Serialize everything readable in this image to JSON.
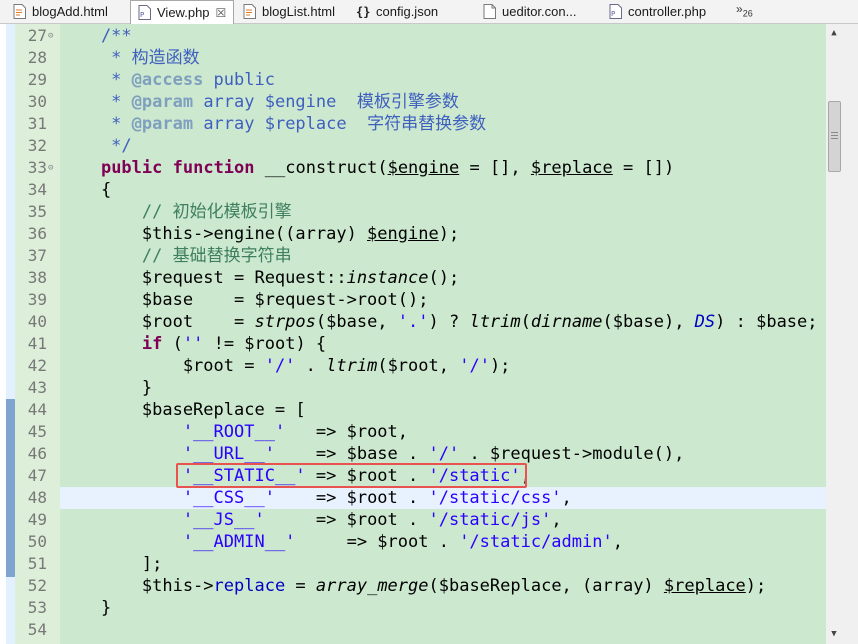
{
  "tabs": [
    {
      "label": "blogAdd.html",
      "icon": "html-file-icon",
      "active": false
    },
    {
      "label": "View.php",
      "icon": "php-file-icon",
      "active": true
    },
    {
      "label": "blogList.html",
      "icon": "html-file-icon",
      "active": false
    },
    {
      "label": "config.json",
      "icon": "json-file-icon",
      "active": false
    },
    {
      "label": "ueditor.con...",
      "icon": "generic-file-icon",
      "active": false
    },
    {
      "label": "controller.php",
      "icon": "php-file-icon",
      "active": false
    }
  ],
  "tab_close_glyph": "☒",
  "overflow": {
    "arrows": "»",
    "count": "26"
  },
  "editor": {
    "current_line": 48,
    "highlighted_line": 47,
    "lines": [
      {
        "n": "27",
        "fold": "⊝",
        "segs": [
          [
            "doc",
            "    /**"
          ]
        ]
      },
      {
        "n": "28",
        "segs": [
          [
            "doc",
            "     * 构造函数"
          ]
        ]
      },
      {
        "n": "29",
        "segs": [
          [
            "doc",
            "     * "
          ],
          [
            "tag",
            "@access"
          ],
          [
            "doc",
            " public"
          ]
        ]
      },
      {
        "n": "30",
        "segs": [
          [
            "doc",
            "     * "
          ],
          [
            "tag",
            "@param"
          ],
          [
            "doc",
            " array $engine  模板引擎参数"
          ]
        ]
      },
      {
        "n": "31",
        "segs": [
          [
            "doc",
            "     * "
          ],
          [
            "tag",
            "@param"
          ],
          [
            "doc",
            " array $replace  字符串替换参数"
          ]
        ]
      },
      {
        "n": "32",
        "segs": [
          [
            "doc",
            "     */"
          ]
        ]
      },
      {
        "n": "33",
        "fold": "⊝",
        "segs": [
          [
            "txt",
            "    "
          ],
          [
            "kw",
            "public"
          ],
          [
            "txt",
            " "
          ],
          [
            "kw",
            "function"
          ],
          [
            "txt",
            " __construct("
          ],
          [
            "uvar",
            "$engine"
          ],
          [
            "txt",
            " = [], "
          ],
          [
            "uvar",
            "$replace"
          ],
          [
            "txt",
            " = [])"
          ]
        ]
      },
      {
        "n": "34",
        "segs": [
          [
            "txt",
            "    {"
          ]
        ]
      },
      {
        "n": "35",
        "segs": [
          [
            "com",
            "        // 初始化模板引擎"
          ]
        ]
      },
      {
        "n": "36",
        "segs": [
          [
            "txt",
            "        $this->engine((array) "
          ],
          [
            "uvar",
            "$engine"
          ],
          [
            "txt",
            ");"
          ]
        ]
      },
      {
        "n": "37",
        "segs": [
          [
            "com",
            "        // 基础替换字符串"
          ]
        ]
      },
      {
        "n": "38",
        "segs": [
          [
            "txt",
            "        $request = Request::"
          ],
          [
            "it",
            "instance"
          ],
          [
            "txt",
            "();"
          ]
        ]
      },
      {
        "n": "39",
        "segs": [
          [
            "txt",
            "        $base    = $request->root();"
          ]
        ]
      },
      {
        "n": "40",
        "segs": [
          [
            "txt",
            "        $root    = "
          ],
          [
            "it",
            "strpos"
          ],
          [
            "txt",
            "($base, "
          ],
          [
            "str",
            "'.'"
          ],
          [
            "txt",
            ") ? "
          ],
          [
            "it",
            "ltrim"
          ],
          [
            "txt",
            "("
          ],
          [
            "it",
            "dirname"
          ],
          [
            "txt",
            "($base), "
          ],
          [
            "cn",
            "DS"
          ],
          [
            "txt",
            ") : $base;"
          ]
        ]
      },
      {
        "n": "41",
        "segs": [
          [
            "txt",
            "        "
          ],
          [
            "kw",
            "if"
          ],
          [
            "txt",
            " ("
          ],
          [
            "str",
            "''"
          ],
          [
            "txt",
            " != $root) {"
          ]
        ]
      },
      {
        "n": "42",
        "segs": [
          [
            "txt",
            "            $root = "
          ],
          [
            "str",
            "'/'"
          ],
          [
            "txt",
            " . "
          ],
          [
            "it",
            "ltrim"
          ],
          [
            "txt",
            "($root, "
          ],
          [
            "str",
            "'/'"
          ],
          [
            "txt",
            ");"
          ]
        ]
      },
      {
        "n": "43",
        "segs": [
          [
            "txt",
            "        }"
          ]
        ]
      },
      {
        "n": "44",
        "segs": [
          [
            "txt",
            "        $baseReplace = ["
          ]
        ]
      },
      {
        "n": "45",
        "segs": [
          [
            "txt",
            "            "
          ],
          [
            "str",
            "'__ROOT__'"
          ],
          [
            "txt",
            "   => $root,"
          ]
        ]
      },
      {
        "n": "46",
        "segs": [
          [
            "txt",
            "            "
          ],
          [
            "str",
            "'__URL__'"
          ],
          [
            "txt",
            "    => $base . "
          ],
          [
            "str",
            "'/'"
          ],
          [
            "txt",
            " . $request->module(),"
          ]
        ]
      },
      {
        "n": "47",
        "segs": [
          [
            "txt",
            "            "
          ],
          [
            "str",
            "'__STATIC__'"
          ],
          [
            "txt",
            " => $root . "
          ],
          [
            "str",
            "'/static'"
          ],
          [
            "txt",
            ","
          ]
        ]
      },
      {
        "n": "48",
        "segs": [
          [
            "txt",
            "            "
          ],
          [
            "str",
            "'__CSS__'"
          ],
          [
            "txt",
            "    => $root . "
          ],
          [
            "str",
            "'/static/css'"
          ],
          [
            "txt",
            ","
          ]
        ]
      },
      {
        "n": "49",
        "segs": [
          [
            "txt",
            "            "
          ],
          [
            "str",
            "'__JS__'"
          ],
          [
            "txt",
            "     => $root . "
          ],
          [
            "str",
            "'/static/js'"
          ],
          [
            "txt",
            ","
          ]
        ]
      },
      {
        "n": "50",
        "segs": [
          [
            "txt",
            "            "
          ],
          [
            "str",
            "'__ADMIN__'"
          ],
          [
            "txt",
            "     => $root . "
          ],
          [
            "str",
            "'/static/admin'"
          ],
          [
            "txt",
            ","
          ]
        ]
      },
      {
        "n": "51",
        "segs": [
          [
            "txt",
            "        ];"
          ]
        ]
      },
      {
        "n": "52",
        "segs": [
          [
            "txt",
            "        $this->"
          ],
          [
            "field",
            "replace"
          ],
          [
            "txt",
            " = "
          ],
          [
            "it",
            "array_merge"
          ],
          [
            "txt",
            "($baseReplace, (array) "
          ],
          [
            "uvar",
            "$replace"
          ],
          [
            "txt",
            ");"
          ]
        ]
      },
      {
        "n": "53",
        "segs": [
          [
            "txt",
            "    }"
          ]
        ]
      },
      {
        "n": "54",
        "segs": [
          [
            "txt",
            ""
          ]
        ]
      }
    ]
  },
  "scrollbar": {
    "up": "▲",
    "down": "▼",
    "position": 0.12
  }
}
